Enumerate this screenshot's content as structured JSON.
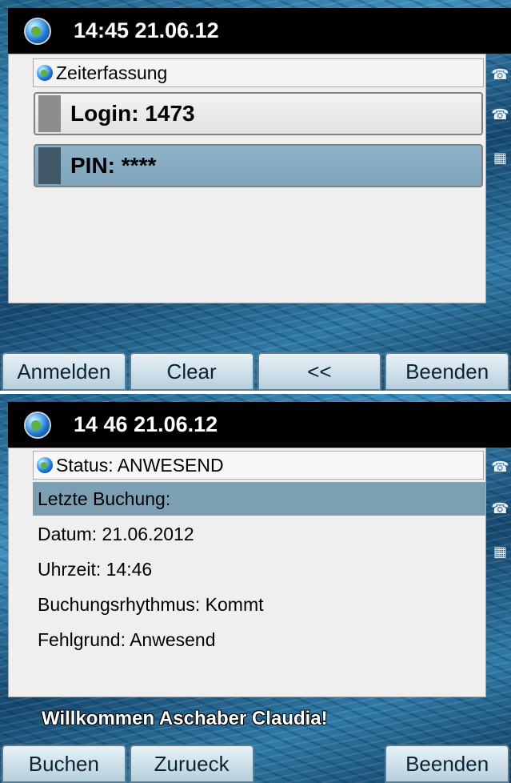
{
  "screen1": {
    "title": "14:45 21.06.12",
    "header": "Zeiterfassung",
    "login_field": "Login: 1473",
    "pin_field": "PIN: ****",
    "softkeys": [
      "Anmelden",
      "Clear",
      "<<",
      "Beenden"
    ]
  },
  "screen2": {
    "title": "14 46 21.06.12",
    "header": "Status: ANWESEND",
    "rows": [
      "Letzte Buchung:",
      "Datum: 21.06.2012",
      "Uhrzeit: 14:46",
      "Buchungsrhythmus: Kommt",
      "Fehlgrund: Anwesend"
    ],
    "welcome": "Willkommen Aschaber Claudia!",
    "softkeys": [
      "Buchen",
      "Zurueck",
      "",
      "Beenden"
    ]
  },
  "icons": {
    "app": "globe-icon",
    "side": [
      "phone-line-icon",
      "phone-line-icon",
      "keypad-icon"
    ]
  },
  "colors": {
    "titlebar": "#000000",
    "selected_row": "#7d9fb4",
    "panel": "#efefef"
  }
}
